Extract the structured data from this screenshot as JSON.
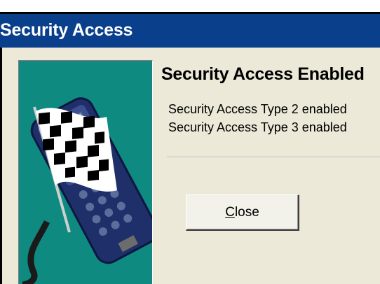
{
  "window": {
    "title": "Security Access"
  },
  "dialog": {
    "heading": "Security Access Enabled",
    "messages": [
      "Security Access Type 2 enabled",
      "Security Access Type 3 enabled"
    ],
    "close_button": {
      "mnemonic": "C",
      "rest": "lose"
    },
    "illustration": {
      "icon": "handheld-scan-tool-with-checkered-flag-icon"
    }
  },
  "colors": {
    "titlebar": "#0a3f8c",
    "client_background": "#ece9d8",
    "illustration_background": "#0e8a80"
  }
}
